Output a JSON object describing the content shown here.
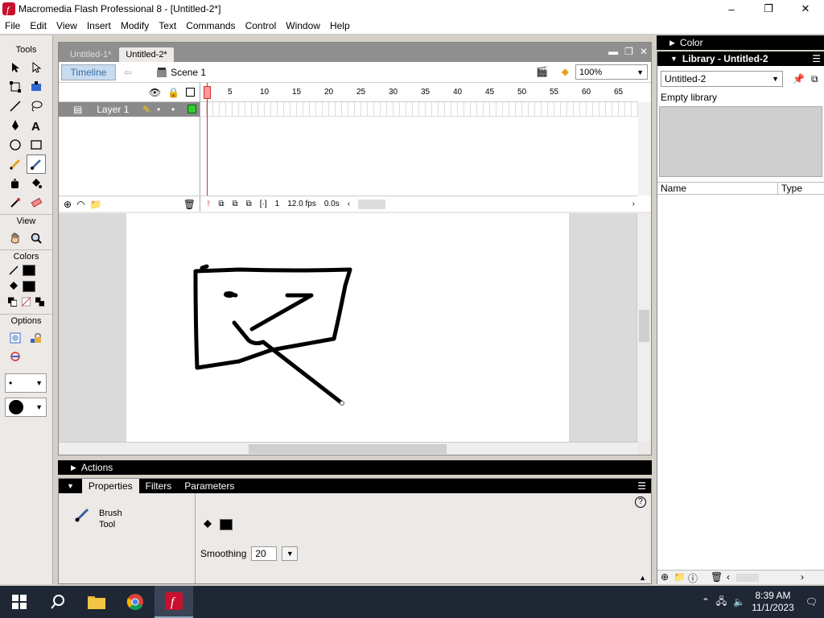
{
  "window": {
    "title": "Macromedia Flash Professional 8 - [Untitled-2*]",
    "minimize": "–",
    "maximize": "❐",
    "close": "✕"
  },
  "menu": [
    "File",
    "Edit",
    "View",
    "Insert",
    "Modify",
    "Text",
    "Commands",
    "Control",
    "Window",
    "Help"
  ],
  "tools": {
    "title": "Tools",
    "view_title": "View",
    "colors_title": "Colors",
    "options_title": "Options"
  },
  "document": {
    "tabs": [
      "Untitled-1*",
      "Untitled-2*"
    ],
    "timeline_button": "Timeline",
    "scene_label": "Scene 1",
    "zoom": "100%"
  },
  "timeline": {
    "layer_name": "Layer 1",
    "ruler_ticks": [
      "1",
      "5",
      "10",
      "15",
      "20",
      "25",
      "30",
      "35",
      "40",
      "45",
      "50",
      "55",
      "60",
      "65"
    ],
    "current_frame": "1",
    "fps": "12.0 fps",
    "elapsed": "0.0s"
  },
  "actions_label": "Actions",
  "properties": {
    "tabs": [
      "Properties",
      "Filters",
      "Parameters"
    ],
    "tool_name_line1": "Brush",
    "tool_name_line2": "Tool",
    "smoothing_label": "Smoothing",
    "smoothing_value": "20"
  },
  "color_panel_label": "Color",
  "library": {
    "title": "Library - Untitled-2",
    "selected_doc": "Untitled-2",
    "empty_text": "Empty library",
    "col_name": "Name",
    "col_type": "Type"
  },
  "taskbar": {
    "time": "8:39 AM",
    "date": "11/1/2023"
  },
  "colors": {
    "stroke": "#000000",
    "fill": "#000000",
    "flash_red": "#c8102e"
  }
}
